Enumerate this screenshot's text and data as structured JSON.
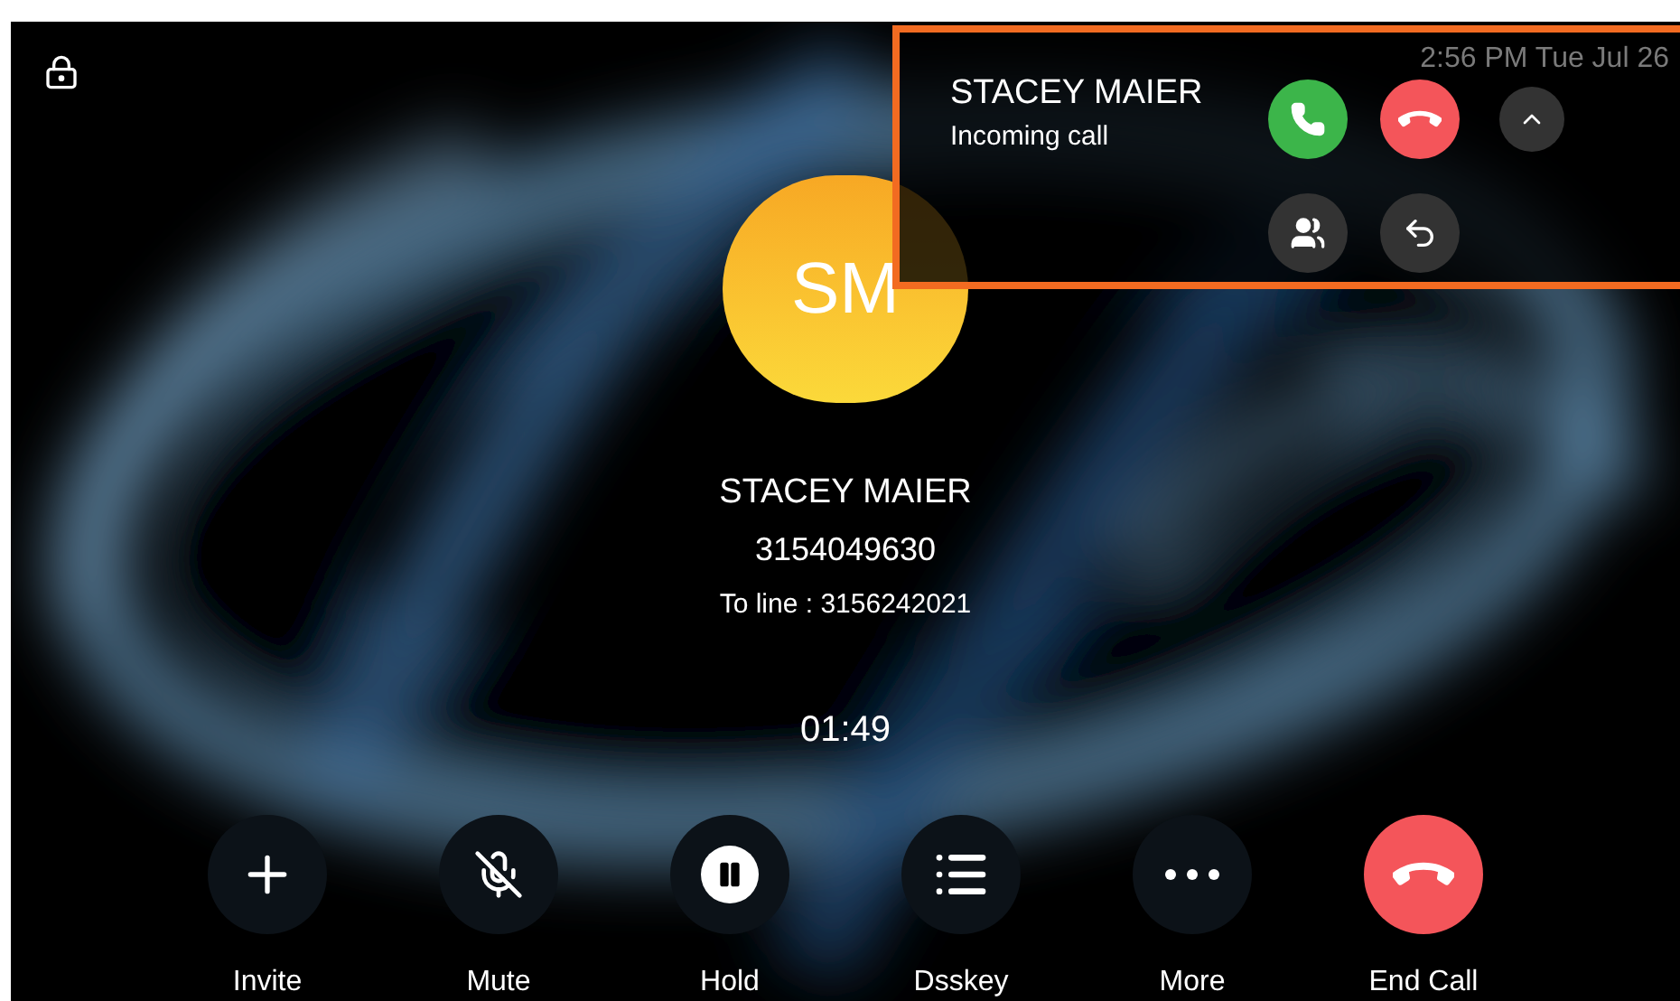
{
  "status_bar": {
    "time": "2:56 PM Tue Jul 26"
  },
  "caller": {
    "initials": "SM",
    "name": "STACEY MAIER",
    "number": "3154049630",
    "line": "To line : 3156242021",
    "duration": "01:49"
  },
  "incoming": {
    "name": "STACEY MAIER",
    "status": "Incoming call"
  },
  "controls": [
    {
      "kind": "invite",
      "label": "Invite"
    },
    {
      "kind": "mute",
      "label": "Mute"
    },
    {
      "kind": "hold",
      "label": "Hold"
    },
    {
      "kind": "dsskey",
      "label": "Dsskey"
    },
    {
      "kind": "more",
      "label": "More"
    },
    {
      "kind": "end",
      "label": "End Call"
    }
  ]
}
